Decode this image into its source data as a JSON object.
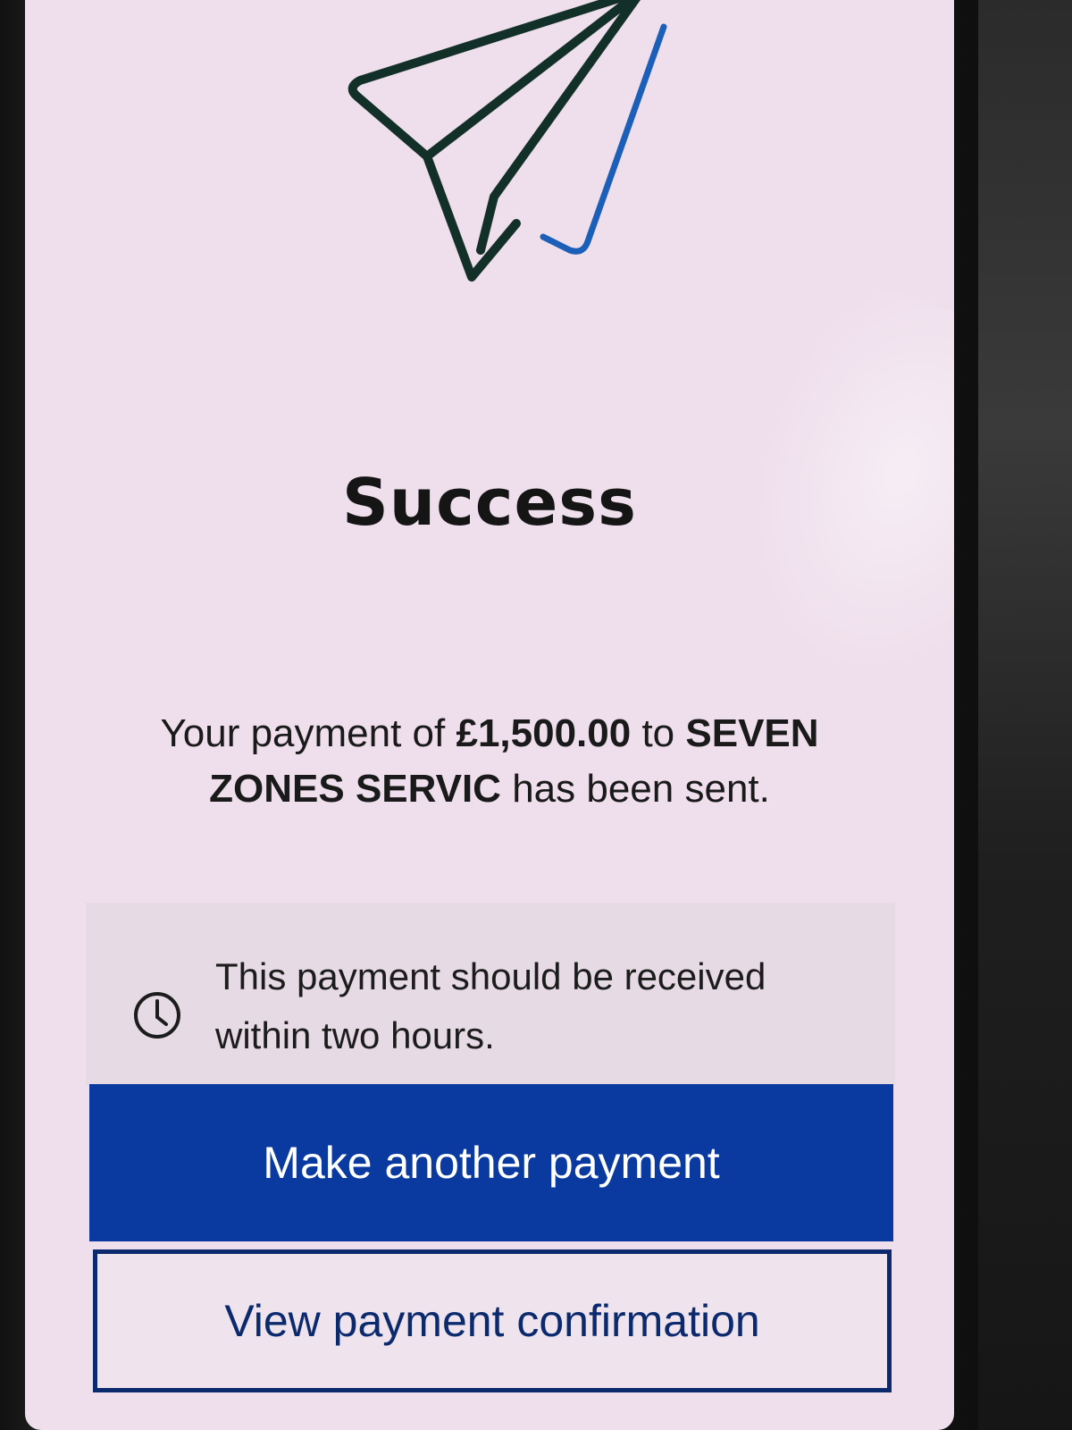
{
  "success": {
    "title": "Success",
    "message_prefix": "Your payment of ",
    "amount": "£1,500.00",
    "message_middle": " to ",
    "payee": "SEVEN ZONES SERVIC",
    "message_suffix": " has been sent."
  },
  "notice": {
    "icon": "clock-icon",
    "text": "This payment should be received within two hours."
  },
  "actions": {
    "primary_label": "Make another payment",
    "secondary_label": "View payment confirmation"
  },
  "colors": {
    "screen_background": "#efdfec",
    "primary_button": "#0a3a9f",
    "secondary_border": "#0b2a6e",
    "icon_accent": "#1b5fb8"
  }
}
